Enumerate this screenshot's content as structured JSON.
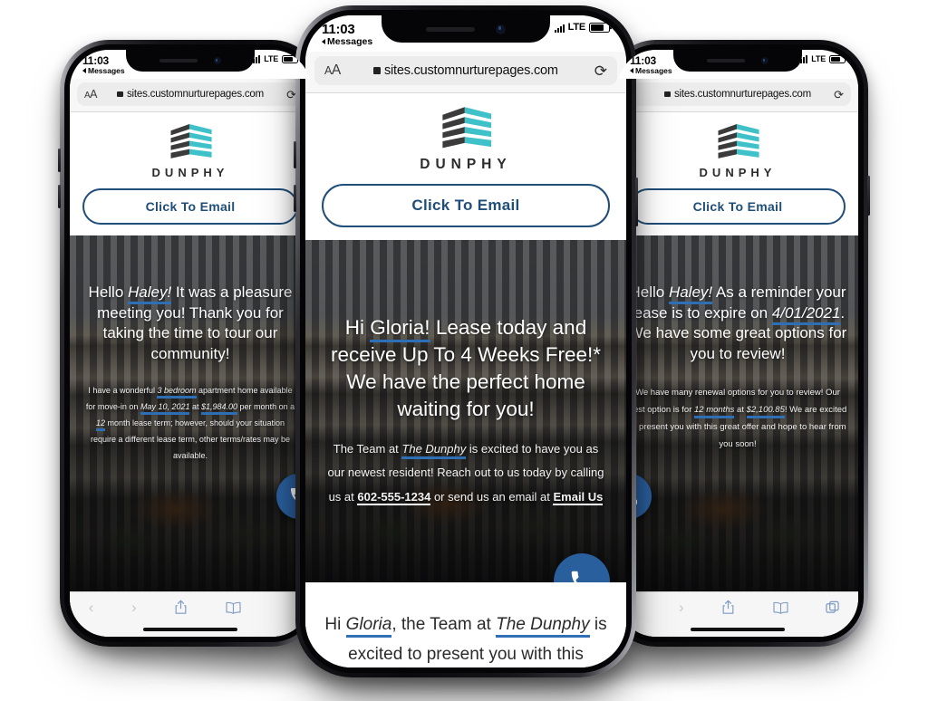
{
  "site": {
    "url": "sites.customnurturepages.com",
    "brand_name": "DUNPHY",
    "cta_label": "Click To Email",
    "accent_blue": "#1f4e79",
    "link_underline_blue": "#2f6fb5",
    "logo_teal": "#3fc1c9",
    "logo_dark": "#3b3b3b",
    "fab_blue": "#2a5f9e"
  },
  "status_bar": {
    "time": "11:03",
    "back_label": "Messages",
    "carrier_tech": "LTE"
  },
  "browser": {
    "aa_label_small": "A",
    "aa_label_large": "A",
    "lock_icon": "lock-icon",
    "reload_icon": "reload-icon",
    "toolbar": {
      "back_icon": "chevron-left-icon",
      "forward_icon": "chevron-right-icon",
      "share_icon": "share-icon",
      "bookmarks_icon": "book-icon",
      "tabs_icon": "tabs-icon"
    }
  },
  "phones": {
    "left": {
      "name": "tour-follow-up-page",
      "headline_parts": [
        {
          "text": "Hello ",
          "style": "plain"
        },
        {
          "text": "Haley!",
          "style": "underline-italic"
        },
        {
          "text": " It was a pleasure meeting you! Thank you for taking the time to tour our community!",
          "style": "plain"
        }
      ],
      "body_parts": [
        {
          "text": "I have a wonderful ",
          "style": "plain"
        },
        {
          "text": "3 bedroom",
          "style": "underline-italic"
        },
        {
          "text": " apartment home available for move-in on ",
          "style": "plain"
        },
        {
          "text": "May 10, 2021",
          "style": "underline-italic"
        },
        {
          "text": " at ",
          "style": "plain"
        },
        {
          "text": "$1,984.00",
          "style": "underline-italic"
        },
        {
          "text": " per month on a ",
          "style": "plain"
        },
        {
          "text": "12",
          "style": "underline-italic"
        },
        {
          "text": " month lease term; however, should your situation require a different lease term, other terms/rates may be available.",
          "style": "plain"
        }
      ]
    },
    "center": {
      "name": "lease-special-page",
      "headline_parts": [
        {
          "text": "Hi ",
          "style": "plain"
        },
        {
          "text": "Gloria!",
          "style": "underline-plain"
        },
        {
          "text": "  Lease today and receive Up To 4 Weeks Free!* We have the perfect home waiting for you!",
          "style": "plain"
        }
      ],
      "body_parts": [
        {
          "text": "The Team at ",
          "style": "plain"
        },
        {
          "text": "The Dunphy",
          "style": "underline-italic"
        },
        {
          "text": " is excited to have you as our newest resident! Reach out to us today by calling us at ",
          "style": "plain"
        },
        {
          "text": "602-555-1234",
          "style": "bold-underline"
        },
        {
          "text": " or send us an email at ",
          "style": "plain"
        },
        {
          "text": "Email Us",
          "style": "bold-underline"
        }
      ],
      "card_parts": [
        {
          "text": "Hi ",
          "style": "plain"
        },
        {
          "text": "Gloria",
          "style": "underline-italic"
        },
        {
          "text": ", the Team at ",
          "style": "plain"
        },
        {
          "text": "The Dunphy",
          "style": "underline-italic"
        },
        {
          "text": " is excited to present you with this limited",
          "style": "plain"
        }
      ]
    },
    "right": {
      "name": "lease-renewal-page",
      "headline_parts": [
        {
          "text": "Hello ",
          "style": "plain"
        },
        {
          "text": "Haley!",
          "style": "underline-italic"
        },
        {
          "text": " As a reminder your lease is to expire on ",
          "style": "plain"
        },
        {
          "text": "4/01/2021",
          "style": "underline-italic"
        },
        {
          "text": ". We have some great options for you to review!",
          "style": "plain"
        }
      ],
      "body_parts": [
        {
          "text": "We have many renewal options for you to review! Our best option is for ",
          "style": "plain"
        },
        {
          "text": "12 months",
          "style": "underline-italic"
        },
        {
          "text": " at ",
          "style": "plain"
        },
        {
          "text": "$2,100.85",
          "style": "underline-italic"
        },
        {
          "text": "! We are excited to present you with this great offer and hope to hear from you soon!",
          "style": "plain"
        }
      ]
    }
  }
}
